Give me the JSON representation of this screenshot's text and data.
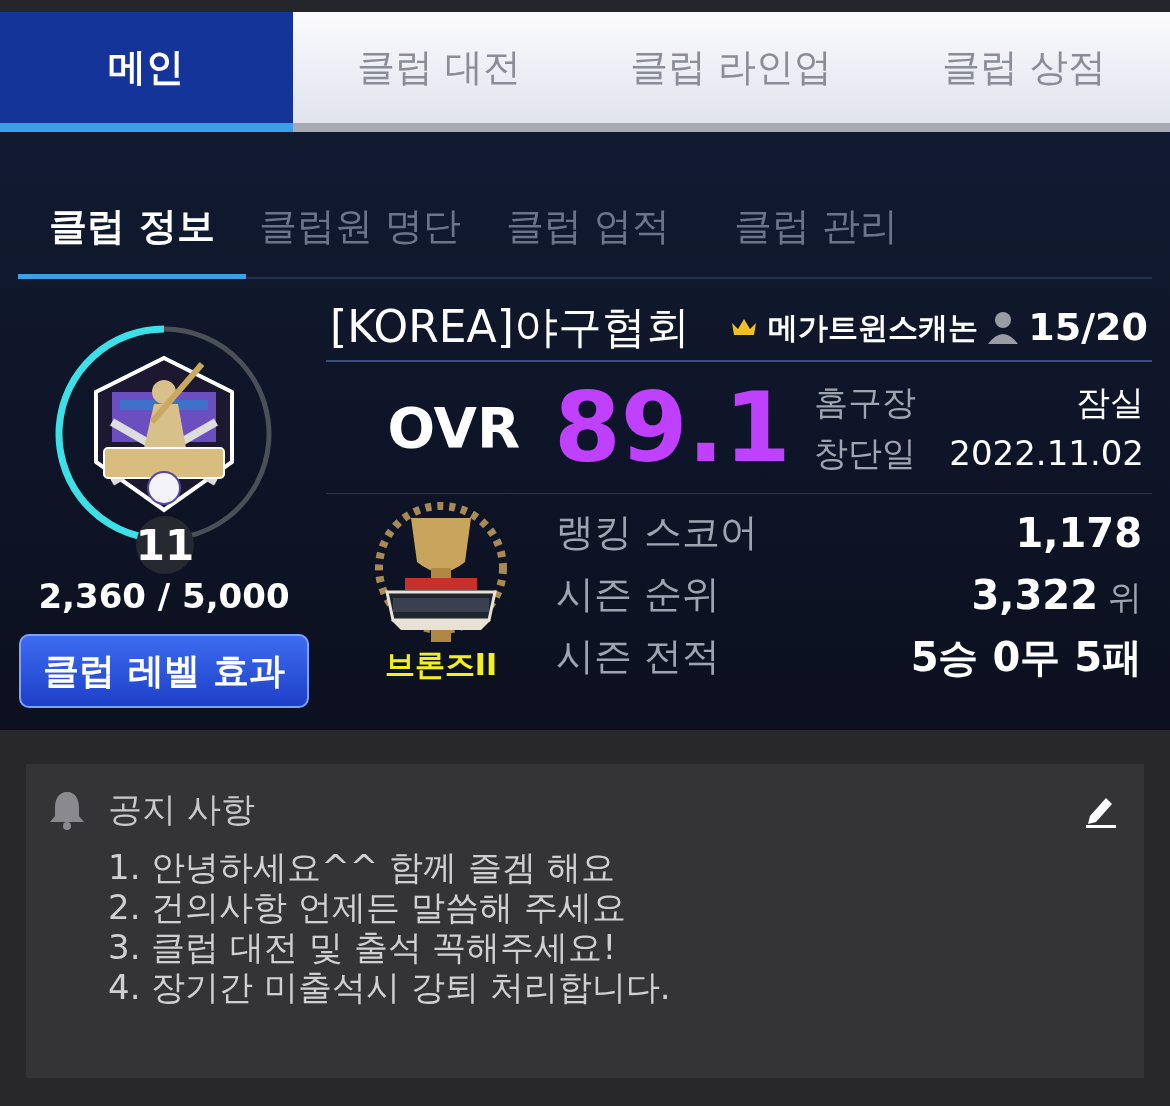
{
  "main_tabs": [
    {
      "label": "메인",
      "selected": true
    },
    {
      "label": "클럽 대전",
      "selected": false
    },
    {
      "label": "클럽 라인업",
      "selected": false
    },
    {
      "label": "클럽 상점",
      "selected": false
    }
  ],
  "sub_tabs": [
    {
      "label": "클럽 정보",
      "selected": true
    },
    {
      "label": "클럽원 명단",
      "selected": false
    },
    {
      "label": "클럽 업적",
      "selected": false
    },
    {
      "label": "클럽 관리",
      "selected": false
    }
  ],
  "club": {
    "name": "[KOREA]야구협회",
    "leader": "메가트윈스캐논",
    "members": "15/20",
    "level": "11",
    "exp": {
      "text": "2,360 / 5,000",
      "level": 0.472
    },
    "level_button": "클럽 레벨 효과",
    "ovr_label": "OVR",
    "ovr": "89.1",
    "info": [
      {
        "label": "홈구장",
        "value": "잠실"
      },
      {
        "label": "창단일",
        "value": "2022.11.02"
      }
    ],
    "league": "브론즈II",
    "stats": [
      {
        "label": "랭킹 스코어",
        "value": "1,178"
      },
      {
        "label": "시즌 순위",
        "value": "3,322",
        "unit": "위"
      },
      {
        "label": "시즌 전적",
        "value": "5승 0무 5패"
      }
    ]
  },
  "notice": {
    "title": "공지 사항",
    "lines": [
      "1. 안녕하세요^^ 함께 즐겜 해요",
      "2. 건의사항 언제든 말씀해 주세요",
      "3. 클럽 대전 및 출석 꼭해주세요!",
      "4. 장기간 미출석시 강퇴 처리합니다."
    ]
  }
}
